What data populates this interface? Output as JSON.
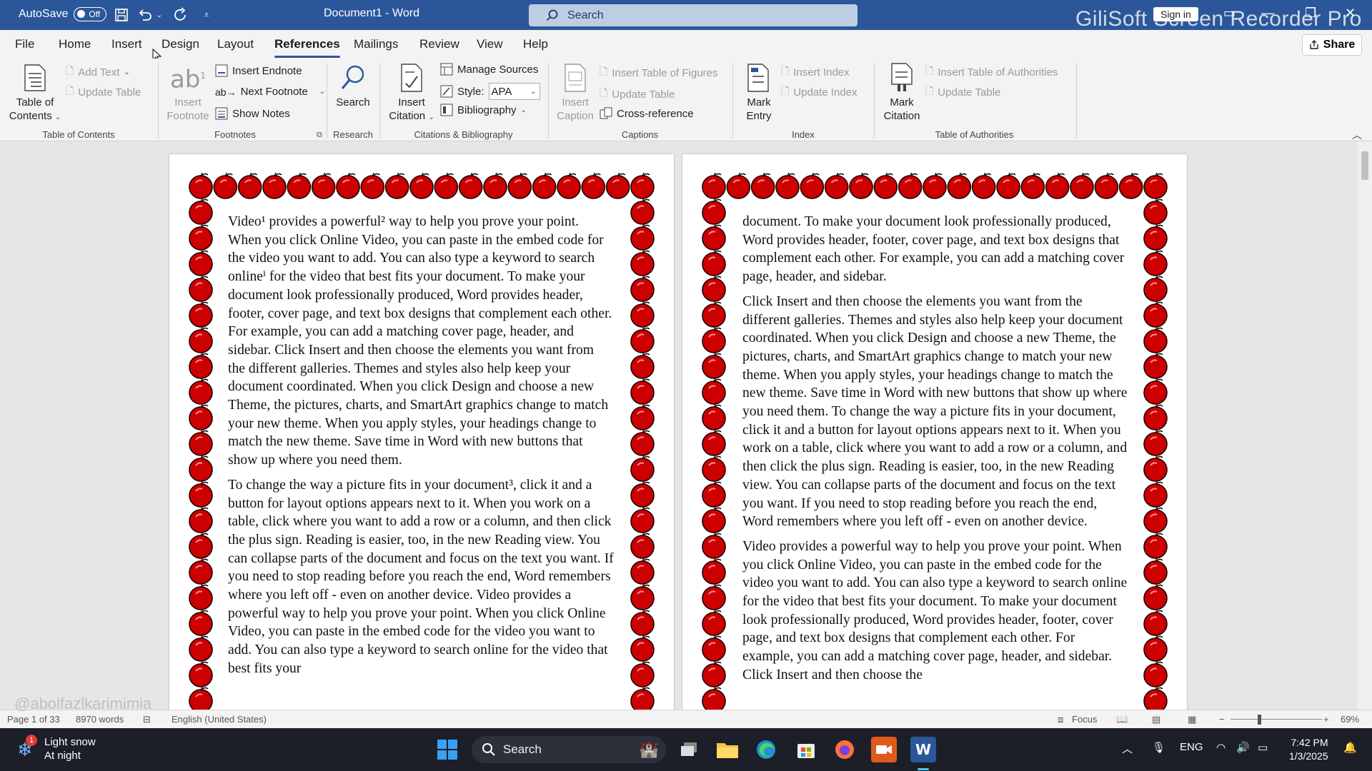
{
  "titlebar": {
    "autosave_label": "AutoSave",
    "autosave_state": "Off",
    "document_title": "Document1  -  Word",
    "search_placeholder": "Search",
    "watermark": "GiliSoft Screen Recorder Pro",
    "signin_label": "Sign in"
  },
  "menu_tabs": [
    {
      "label": "File"
    },
    {
      "label": "Home"
    },
    {
      "label": "Insert"
    },
    {
      "label": "Design"
    },
    {
      "label": "Layout"
    },
    {
      "label": "References"
    },
    {
      "label": "Mailings"
    },
    {
      "label": "Review"
    },
    {
      "label": "View"
    },
    {
      "label": "Help"
    }
  ],
  "active_tab": "References",
  "share_label": "Share",
  "ribbon": {
    "toc": {
      "table_of_contents_line1": "Table of",
      "table_of_contents_line2": "Contents",
      "add_text": "Add Text",
      "update_table": "Update Table",
      "group_label": "Table of Contents"
    },
    "footnotes": {
      "insert_footnote_line1": "Insert",
      "insert_footnote_line2": "Footnote",
      "insert_endnote": "Insert Endnote",
      "next_footnote": "Next Footnote",
      "show_notes": "Show Notes",
      "group_label": "Footnotes"
    },
    "research": {
      "search": "Search",
      "group_label": "Research"
    },
    "citations": {
      "insert_citation_line1": "Insert",
      "insert_citation_line2": "Citation",
      "manage_sources": "Manage Sources",
      "style_label": "Style:",
      "style_value": "APA",
      "bibliography": "Bibliography",
      "group_label": "Citations & Bibliography"
    },
    "captions": {
      "insert_caption_line1": "Insert",
      "insert_caption_line2": "Caption",
      "insert_table_of_figures": "Insert Table of Figures",
      "update_table": "Update Table",
      "cross_reference": "Cross-reference",
      "group_label": "Captions"
    },
    "index": {
      "mark_entry_line1": "Mark",
      "mark_entry_line2": "Entry",
      "insert_index": "Insert Index",
      "update_index": "Update Index",
      "group_label": "Index"
    },
    "authorities": {
      "mark_citation_line1": "Mark",
      "mark_citation_line2": "Citation",
      "insert_table_of_authorities": "Insert Table of Authorities",
      "update_table": "Update Table",
      "group_label": "Table of Authorities"
    }
  },
  "page_left": {
    "paragraphs": [
      "Video¹ provides a powerful² way to help you prove your point. When you click Online Video, you can paste in the embed code for the video you want to add. You can also type a keyword to search onlineⁱ for the video that best fits your document. To make your document look professionally produced, Word provides header, footer, cover page, and text box designs that complement each other. For example, you can add a matching cover page, header, and sidebar. Click Insert and then choose the elements you want from the different galleries. Themes and styles also help keep your document coordinated. When you click Design and choose a new Theme, the pictures, charts, and SmartArt graphics change to match your new theme. When you apply styles, your headings change to match the new theme. Save time in Word with new buttons that show up where you need them.",
      "To change the way a picture fits in your document³, click it and a button for layout options appears next to it. When you work on a table, click where you want to add a row or a column, and then click the plus sign. Reading is easier, too, in the new Reading view. You can collapse parts of the document and focus on the text you want. If you need to stop reading before you reach the end, Word remembers where you left off - even on another device. Video provides a powerful way to help you prove your point. When you click Online Video, you can paste in the embed code for the video you want to add. You can also type a keyword to search online for the video that best fits your"
    ]
  },
  "page_right": {
    "paragraphs": [
      "document. To make your document look professionally produced, Word provides header, footer, cover page, and text box designs that complement each other. For example, you can add a matching cover page, header, and sidebar.",
      "Click Insert and then choose the elements you want from the different galleries. Themes and styles also help keep your document coordinated. When you click Design and choose a new Theme, the pictures, charts, and SmartArt graphics change to match your new theme. When you apply styles, your headings change to match the new theme. Save time in Word with new buttons that show up where you need them. To change the way a picture fits in your document, click it and a button for layout options appears next to it. When you work on a table, click where you want to add a row or a column, and then click the plus sign. Reading is easier, too, in the new Reading view. You can collapse parts of the document and focus on the text you want. If you need to stop reading before you reach the end, Word remembers where you left off - even on another device.",
      "Video provides a powerful way to help you prove your point. When you click Online Video, you can paste in the embed code for the video you want to add. You can also type a keyword to search online for the video that best fits your document. To make your document look professionally produced, Word provides header, footer, cover page, and text box designs that complement each other. For example, you can add a matching cover page, header, and sidebar. Click Insert and then choose the"
    ]
  },
  "statusbar": {
    "page": "Page 1 of 33",
    "words": "8970 words",
    "language": "English (United States)",
    "focus": "Focus",
    "zoom": "69%",
    "overlay_text": "@abolfazlkarimimia"
  },
  "taskbar": {
    "weather_title": "Light snow",
    "weather_sub": "At night",
    "weather_badge": "1",
    "search_label": "Search",
    "language": "ENG",
    "time": "7:42 PM",
    "date": "1/3/2025"
  },
  "colors": {
    "word_blue": "#2b579a",
    "apple_red": "#cc0000",
    "taskbar": "#1c1f27"
  }
}
